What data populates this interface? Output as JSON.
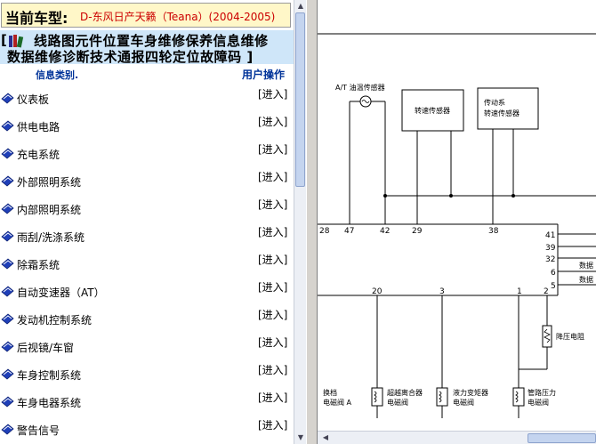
{
  "vehicle": {
    "label": "当前车型:",
    "value": "D-东风日产天籁（Teana）(2004-2005)"
  },
  "categories": {
    "bracket_left": "[",
    "row1": [
      "线路图",
      "元件位置",
      "车身维修",
      "保养信息",
      "维修"
    ],
    "row2": [
      "数据",
      "维修诊断",
      "技术通报",
      "四轮定位",
      "故障码"
    ],
    "bracket_right": "]"
  },
  "table": {
    "col_info": "信息类别.",
    "col_action": "用户操作",
    "rows": [
      {
        "name": "仪表板",
        "action": "[进入]"
      },
      {
        "name": "供电电路",
        "action": "[进入]"
      },
      {
        "name": "充电系统",
        "action": "[进入]"
      },
      {
        "name": "外部照明系统",
        "action": "[进入]"
      },
      {
        "name": "内部照明系统",
        "action": "[进入]"
      },
      {
        "name": "雨刮/洗涤系统",
        "action": "[进入]"
      },
      {
        "name": "除霜系统",
        "action": "[进入]"
      },
      {
        "name": "自动变速器（AT）",
        "action": "[进入]"
      },
      {
        "name": "发动机控制系统",
        "action": "[进入]"
      },
      {
        "name": "后视镜/车窗",
        "action": "[进入]"
      },
      {
        "name": "车身控制系统",
        "action": "[进入]"
      },
      {
        "name": "车身电器系统",
        "action": "[进入]"
      },
      {
        "name": "警告信号",
        "action": "[进入]"
      }
    ]
  },
  "diagram": {
    "sensor_at_temp": "A/T 油温传感器",
    "speed_sensor": "转速传感器",
    "drivetrain_line1": "传动系",
    "drivetrain_line2": "转速传感器",
    "pins_top": [
      "28",
      "47",
      "42",
      "29",
      "38"
    ],
    "pins_right": [
      "41",
      "39",
      "32",
      "6",
      "5"
    ],
    "data_labels": [
      "数据",
      "数据"
    ],
    "pins_bottom": [
      "20",
      "3",
      "1",
      "2"
    ],
    "pressure_resistor": "降压电阻",
    "shift_valve_l1": "换档",
    "shift_valve_l2": "电磁阀 A",
    "overrun_l1": "超越离合器",
    "overrun_l2": "电磁阀",
    "torque_conv_l1": "液力变矩器",
    "torque_conv_l2": "电磁阀",
    "line_pressure_l1": "管路压力",
    "line_pressure_l2": "电磁阀"
  }
}
